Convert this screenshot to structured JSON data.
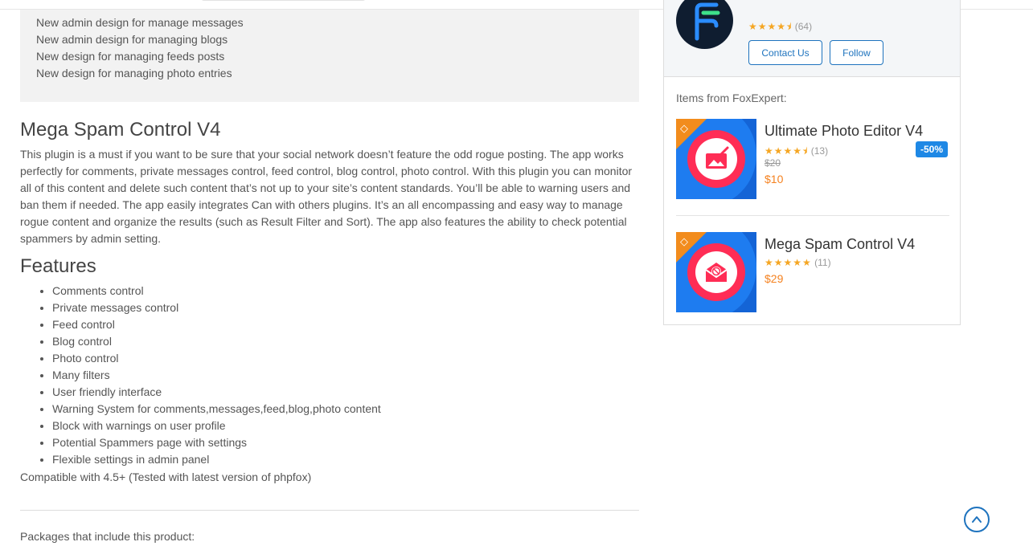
{
  "changelog": {
    "items": [
      "New admin design for manage messages",
      "New admin design for managing blogs",
      "New design for managing feeds posts",
      "New design for managing photo entries"
    ]
  },
  "product": {
    "title": "Mega Spam Control V4",
    "description": "This plugin is a must if you want to be sure that your social network doesn’t feature the odd rogue posting. The app works perfectly for comments, private messages control, feed control, blog control, photo control. With this plugin you can monitor all of this content and delete such content that’s not up to your site’s content standards. You’ll be able to warning users and ban them if needed. The app easily integrates Can with others plugins. It’s an all encompassing and easy way to manage rogue content and organize the results (such as Result Filter and Sort). The app also features the ability to check potential spammers by admin setting.",
    "features_title": "Features",
    "features": [
      "Comments control",
      "Private messages control",
      "Feed control",
      "Blog control",
      "Photo control",
      "Many filters",
      "User friendly interface",
      "Warning System for comments,messages,feed,blog,photo content",
      "Block with warnings on user profile",
      "Potential Spammers page with settings",
      "Flexible settings in admin panel"
    ],
    "compatibility": "Compatible with 4.5+ (Tested with latest version of phpfox)",
    "packages_label": "Packages that include this product:"
  },
  "seller": {
    "rating_stars": "★★★★⯨",
    "rating_count": "(64)",
    "contact_label": "Contact Us",
    "follow_label": "Follow",
    "logo_icon": "foxexpert-logo"
  },
  "related": {
    "label": "Items from FoxExpert:",
    "items": [
      {
        "name": "Ultimate Photo Editor V4",
        "stars": "★★★★⯨",
        "count": "(13)",
        "old_price": "$20",
        "price": "$10",
        "discount": "-50%",
        "icon": "photo-edit-icon"
      },
      {
        "name": "Mega Spam Control V4",
        "stars": "★★★★★",
        "count": "(11)",
        "price": "$29",
        "icon": "spam-mail-icon"
      }
    ]
  },
  "colors": {
    "accent": "#1e73be",
    "star": "#f5a623",
    "price": "#f58220",
    "badge": "#1e88e5",
    "thumb_ring": "#ff2d55",
    "thumb_corner": "#f28c1d"
  }
}
